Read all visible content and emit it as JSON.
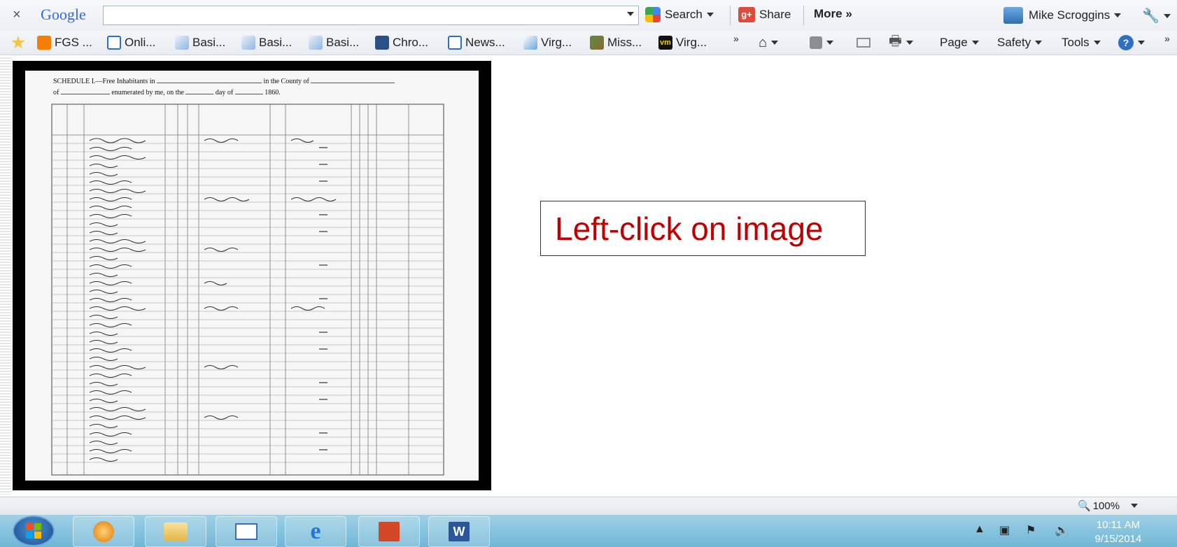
{
  "toolbar": {
    "google_label": "Google",
    "search_value": "",
    "search_button": "Search",
    "share_button": "Share",
    "more_button": "More »",
    "user_name": "Mike Scroggins"
  },
  "favorites": [
    {
      "label": "FGS ..."
    },
    {
      "label": "Onli..."
    },
    {
      "label": "Basi..."
    },
    {
      "label": "Basi..."
    },
    {
      "label": "Basi..."
    },
    {
      "label": "Chro..."
    },
    {
      "label": "News..."
    },
    {
      "label": "Virg..."
    },
    {
      "label": "Miss..."
    },
    {
      "label": "Virg..."
    }
  ],
  "commandbar": {
    "page": "Page",
    "safety": "Safety",
    "tools": "Tools"
  },
  "document": {
    "header_line1": "SCHEDULE I.—Free Inhabitants in",
    "header_county": "in the County of",
    "header_line2": "of",
    "header_enumerated": "enumerated by me, on the",
    "header_day": "day of",
    "header_year": "1860."
  },
  "callout": {
    "text": "Left-click on image"
  },
  "statusbar": {
    "zoom": "100%"
  },
  "taskbar": {
    "time": "10:11 AM",
    "date": "9/15/2014"
  }
}
